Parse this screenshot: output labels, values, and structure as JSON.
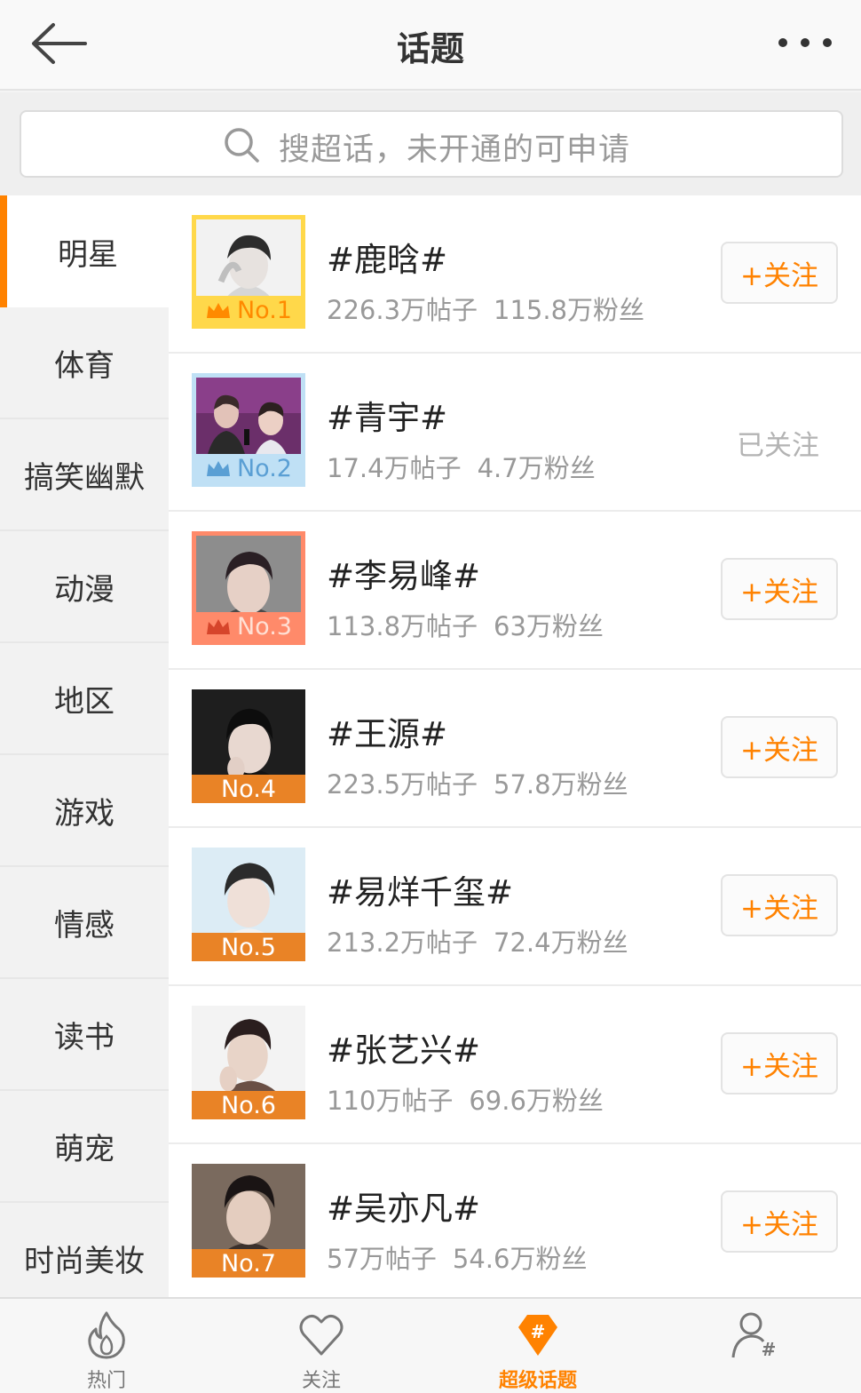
{
  "header": {
    "title": "话题"
  },
  "search": {
    "placeholder": "搜超话，未开通的可申请"
  },
  "sidebar": {
    "items": [
      {
        "label": "明星",
        "active": true
      },
      {
        "label": "体育"
      },
      {
        "label": "搞笑幽默"
      },
      {
        "label": "动漫"
      },
      {
        "label": "地区"
      },
      {
        "label": "游戏"
      },
      {
        "label": "情感"
      },
      {
        "label": "读书"
      },
      {
        "label": "萌宠"
      },
      {
        "label": "时尚美妆"
      }
    ]
  },
  "topics": [
    {
      "rank": "No.1",
      "name": "#鹿晗#",
      "posts": "226.3万帖子",
      "fans": "115.8万粉丝",
      "followed": false
    },
    {
      "rank": "No.2",
      "name": "#青宇#",
      "posts": "17.4万帖子",
      "fans": "4.7万粉丝",
      "followed": true
    },
    {
      "rank": "No.3",
      "name": "#李易峰#",
      "posts": "113.8万帖子",
      "fans": "63万粉丝",
      "followed": false
    },
    {
      "rank": "No.4",
      "name": "#王源#",
      "posts": "223.5万帖子",
      "fans": "57.8万粉丝",
      "followed": false
    },
    {
      "rank": "No.5",
      "name": "#易烊千玺#",
      "posts": "213.2万帖子",
      "fans": "72.4万粉丝",
      "followed": false
    },
    {
      "rank": "No.6",
      "name": "#张艺兴#",
      "posts": "110万帖子",
      "fans": "69.6万粉丝",
      "followed": false
    },
    {
      "rank": "No.7",
      "name": "#吴亦凡#",
      "posts": "57万帖子",
      "fans": "54.6万粉丝",
      "followed": false
    }
  ],
  "labels": {
    "follow": "+关注",
    "followed": "已关注"
  },
  "tabbar": {
    "items": [
      {
        "label": "热门",
        "icon": "flame-icon"
      },
      {
        "label": "关注",
        "icon": "heart-icon"
      },
      {
        "label": "超级话题",
        "icon": "hashtag-diamond-icon",
        "active": true
      },
      {
        "label": "",
        "icon": "user-hashtag-icon"
      }
    ]
  },
  "colors": {
    "accent": "#ff8200",
    "rank1": "#ffd84a",
    "rank2": "#bfe0f5",
    "rank3": "#ff8a6a",
    "rank_default": "#e98326"
  }
}
